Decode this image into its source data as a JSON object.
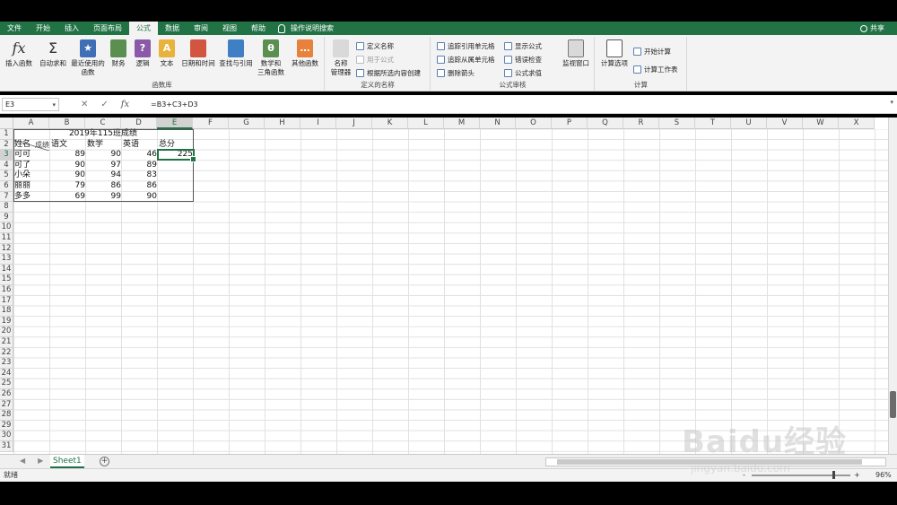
{
  "ribbon_tabs": [
    "文件",
    "开始",
    "插入",
    "页面布局",
    "公式",
    "数据",
    "审阅",
    "视图",
    "帮助"
  ],
  "active_tab": "公式",
  "tell_me": "操作说明搜索",
  "share": "共享",
  "function_library": {
    "group_label": "函数库",
    "insert_function": "插入函数",
    "insert_function_icon": "fx",
    "autosum": "自动求和",
    "recent": [
      "最近使用的",
      "函数"
    ],
    "financial": "财务",
    "logical": "逻辑",
    "text": "文本",
    "datetime": "日期和时间",
    "lookup": "查找与引用",
    "math": [
      "数学和",
      "三角函数"
    ],
    "more": "其他函数"
  },
  "defined_names": {
    "group_label": "定义的名称",
    "name_manager": [
      "名称",
      "管理器"
    ],
    "define_name": "定义名称",
    "use_in_formula": "用于公式",
    "create_from_selection": "根据所选内容创建"
  },
  "formula_auditing": {
    "group_label": "公式审核",
    "trace_precedents": "追踪引用单元格",
    "trace_dependents": "追踪从属单元格",
    "remove_arrows": "删除箭头",
    "show_formulas": "显示公式",
    "error_checking": "错误检查",
    "evaluate_formula": "公式求值",
    "watch_window": "监视窗口"
  },
  "calculation": {
    "group_label": "计算",
    "options": "计算选项",
    "calc_now": "开始计算",
    "calc_sheet": "计算工作表"
  },
  "formula_bar": {
    "name_box": "E3",
    "formula": "=B3+C3+D3",
    "fx_label": "fx"
  },
  "columns": [
    "A",
    "B",
    "C",
    "D",
    "E",
    "F",
    "G",
    "H",
    "I",
    "J",
    "K",
    "L",
    "M",
    "N",
    "O",
    "P",
    "Q",
    "R",
    "S",
    "T",
    "U",
    "V",
    "W",
    "X"
  ],
  "rows": [
    "1",
    "2",
    "3",
    "4",
    "5",
    "6",
    "7",
    "8",
    "9",
    "10",
    "11",
    "12",
    "13",
    "14",
    "15",
    "16",
    "17",
    "18",
    "19",
    "20",
    "21",
    "22",
    "23",
    "24",
    "25",
    "26",
    "27",
    "28",
    "29",
    "30",
    "31"
  ],
  "selected_column": "E",
  "selected_row": "3",
  "sheet": {
    "title": "2019年115班成绩",
    "header_a_left": "姓名",
    "header_a_right": "成绩",
    "header_b": "语文",
    "header_c": "数学",
    "header_d": "英语",
    "header_e": "总分",
    "rows": [
      {
        "name": "可可",
        "chinese": "89",
        "math": "90",
        "english": "46",
        "total": "225"
      },
      {
        "name": "可了",
        "chinese": "90",
        "math": "97",
        "english": "89",
        "total": ""
      },
      {
        "name": "小朵",
        "chinese": "90",
        "math": "94",
        "english": "83",
        "total": ""
      },
      {
        "name": "丽丽",
        "chinese": "79",
        "math": "86",
        "english": "86",
        "total": ""
      },
      {
        "name": "多多",
        "chinese": "69",
        "math": "99",
        "english": "90",
        "total": ""
      }
    ]
  },
  "sheet_tabs": [
    "Sheet1"
  ],
  "status": {
    "ready": "就绪",
    "zoom": "96%",
    "zoom_minus": "-",
    "zoom_plus": "+"
  },
  "watermark": {
    "main": "Baidu经验",
    "sub": "jingyan.baidu.com"
  },
  "colors": {
    "excel_green": "#217346",
    "ribbon_bg": "#f3f3f3"
  }
}
